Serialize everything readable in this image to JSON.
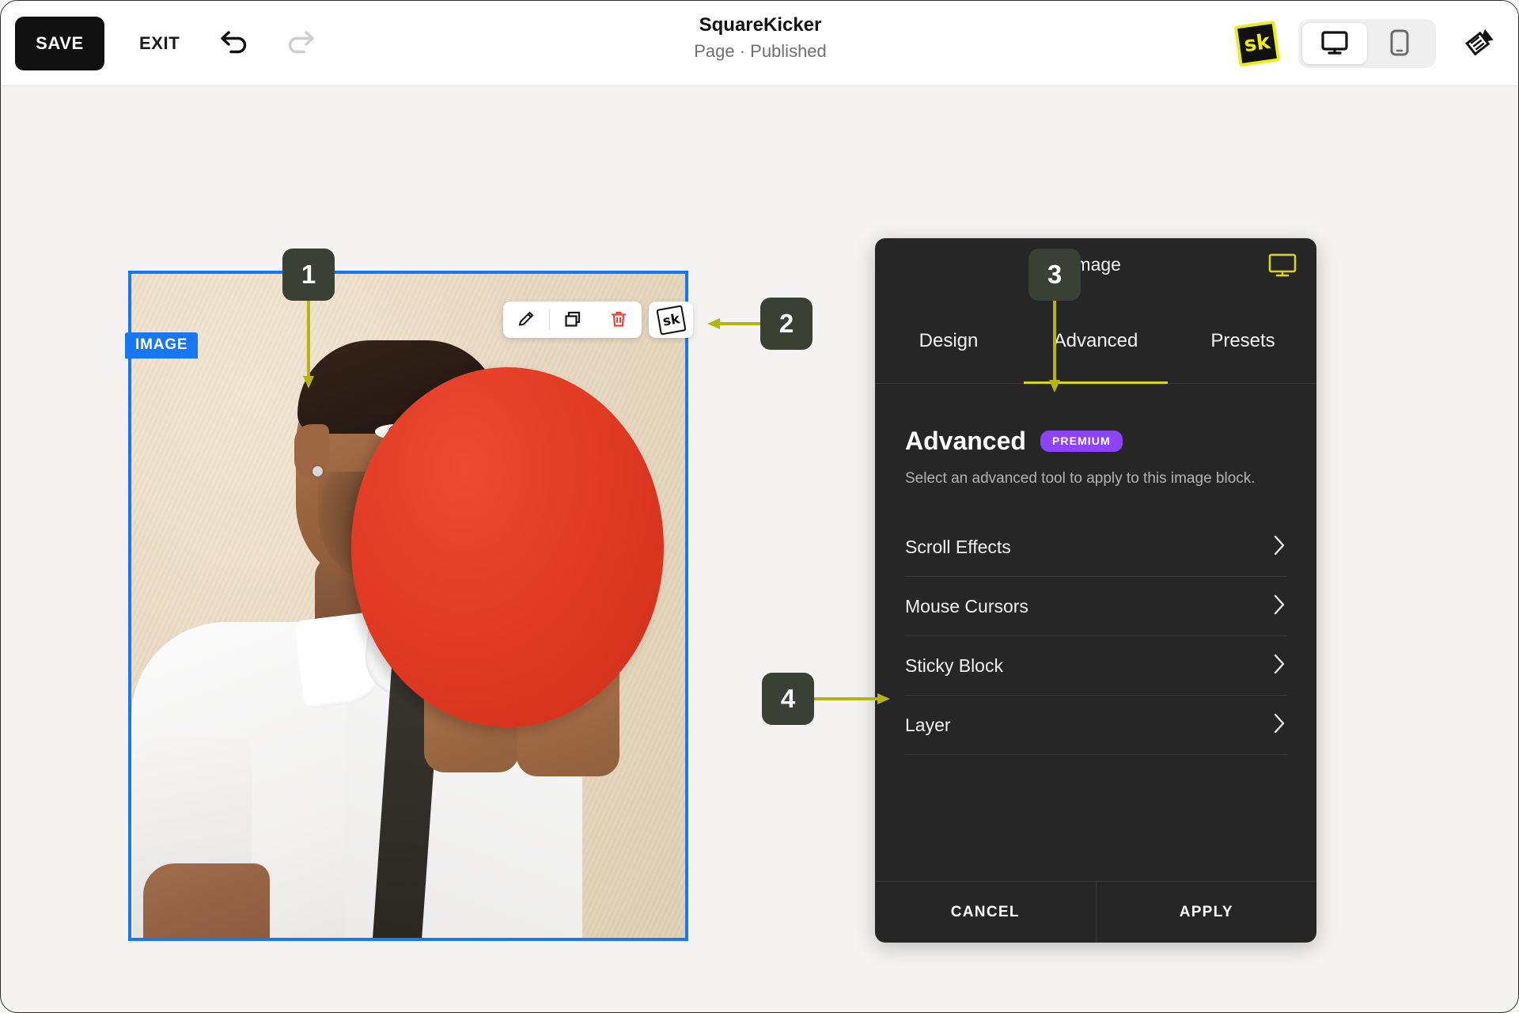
{
  "header": {
    "save_label": "SAVE",
    "exit_label": "EXIT",
    "undo_icon": "undo-arrow-icon",
    "redo_icon": "redo-arrow-icon",
    "title": "SquareKicker",
    "status": "Page · Published",
    "logo_text": "sk",
    "device_desktop_icon": "desktop-monitor-icon",
    "device_mobile_icon": "mobile-phone-icon",
    "brush_icon": "paintbrush-icon",
    "active_device": "desktop"
  },
  "canvas": {
    "block_label": "IMAGE",
    "selection_color": "#1877f2",
    "image_alt": "Man in white shirt and dark tie holding a large red circle over half of his face against a beige wall"
  },
  "block_toolbar": {
    "edit_icon": "pencil-edit-icon",
    "duplicate_icon": "duplicate-copy-icon",
    "delete_icon": "trash-delete-icon",
    "sk_icon": "sk-logo-icon",
    "sk_text": "sk",
    "delete_color": "#e8453c"
  },
  "panel": {
    "title": "Image",
    "monitor_icon": "desktop-monitor-icon",
    "accent_color": "#d6d622",
    "tabs": [
      {
        "label": "Design",
        "active": false
      },
      {
        "label": "Advanced",
        "active": true
      },
      {
        "label": "Presets",
        "active": false
      }
    ],
    "section": {
      "title": "Advanced",
      "badge": "PREMIUM",
      "badge_color": "#8b44f7",
      "description": "Select an advanced tool to apply to this image block."
    },
    "items": [
      {
        "label": "Scroll Effects",
        "chevron": "chevron-right-icon"
      },
      {
        "label": "Mouse Cursors",
        "chevron": "chevron-right-icon"
      },
      {
        "label": "Sticky Block",
        "chevron": "chevron-right-icon"
      },
      {
        "label": "Layer",
        "chevron": "chevron-right-icon"
      }
    ],
    "footer": {
      "cancel_label": "CANCEL",
      "apply_label": "APPLY"
    }
  },
  "annotations": {
    "badge_color": "#3a4034",
    "arrow_color": "#b5b512",
    "items": [
      {
        "number": "1",
        "target": "image block",
        "direction": "down"
      },
      {
        "number": "2",
        "target": "block toolbar",
        "direction": "left"
      },
      {
        "number": "3",
        "target": "advanced tab",
        "direction": "down"
      },
      {
        "number": "4",
        "target": "sticky block item",
        "direction": "right"
      }
    ]
  }
}
